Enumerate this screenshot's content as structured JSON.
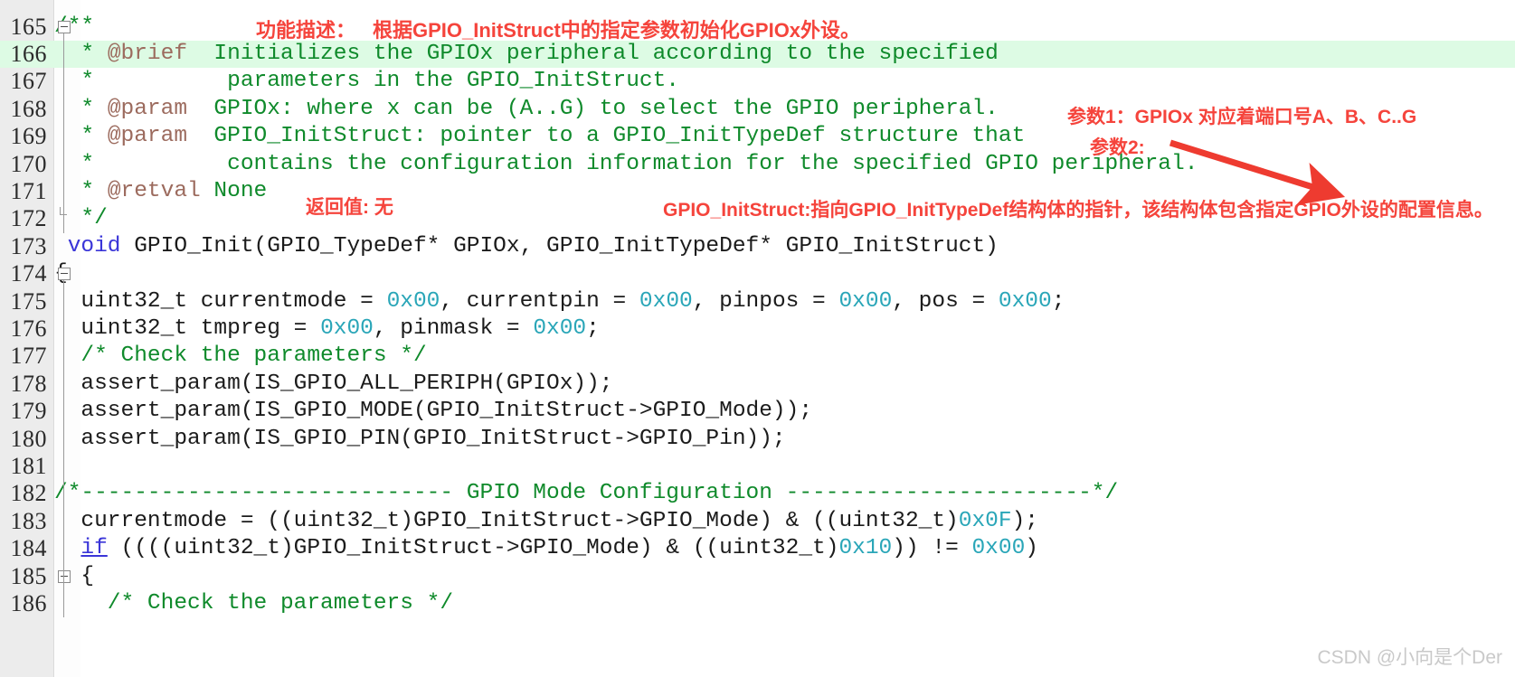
{
  "editor": {
    "gutter_bg": "#ececec",
    "highlight_color": "#ddfbe4",
    "comment_color": "#0f8a2b",
    "keyword_color": "#3a35d8",
    "number_color": "#2aa6b8",
    "doc_tag_color": "#9c6b5e",
    "annotation_color": "#f5443c",
    "partial_top_line": "164",
    "highlighted_line": "166",
    "lines": [
      {
        "number": "165",
        "fold": "open",
        "tokens": [
          {
            "t": "/**",
            "c": "cmt"
          }
        ]
      },
      {
        "number": "166",
        "fold": "bar",
        "highlight": true,
        "tokens": [
          {
            "t": "  * ",
            "c": "cmt"
          },
          {
            "t": "@brief",
            "c": "tag"
          },
          {
            "t": "  Initializes the GPIOx peripheral according to the specified",
            "c": "cmt"
          }
        ]
      },
      {
        "number": "167",
        "fold": "bar",
        "tokens": [
          {
            "t": "  *          parameters in the GPIO_InitStruct.",
            "c": "cmt"
          }
        ]
      },
      {
        "number": "168",
        "fold": "bar",
        "tokens": [
          {
            "t": "  * ",
            "c": "cmt"
          },
          {
            "t": "@param",
            "c": "tag"
          },
          {
            "t": "  GPIOx: where x can be (A..G) to select the GPIO peripheral.",
            "c": "cmt"
          }
        ]
      },
      {
        "number": "169",
        "fold": "bar",
        "tokens": [
          {
            "t": "  * ",
            "c": "cmt"
          },
          {
            "t": "@param",
            "c": "tag"
          },
          {
            "t": "  GPIO_InitStruct: pointer to a GPIO_InitTypeDef structure that",
            "c": "cmt"
          }
        ]
      },
      {
        "number": "170",
        "fold": "bar",
        "tokens": [
          {
            "t": "  *          contains the configuration information for the specified GPIO peripheral.",
            "c": "cmt"
          }
        ]
      },
      {
        "number": "171",
        "fold": "bar",
        "tokens": [
          {
            "t": "  * ",
            "c": "cmt"
          },
          {
            "t": "@retval",
            "c": "tag"
          },
          {
            "t": " None",
            "c": "cmt"
          }
        ]
      },
      {
        "number": "172",
        "fold": "end",
        "tokens": [
          {
            "t": "  */",
            "c": "cmt"
          }
        ]
      },
      {
        "number": "173",
        "fold": "none",
        "tokens": [
          {
            "t": " ",
            "c": "pln"
          },
          {
            "t": "void",
            "c": "kw"
          },
          {
            "t": " GPIO_Init(GPIO_TypeDef* GPIOx, GPIO_InitTypeDef* GPIO_InitStruct)",
            "c": "pln"
          }
        ]
      },
      {
        "number": "174",
        "fold": "open",
        "tokens": [
          {
            "t": "{",
            "c": "pln"
          }
        ]
      },
      {
        "number": "175",
        "fold": "bar",
        "tokens": [
          {
            "t": "  uint32_t currentmode = ",
            "c": "pln"
          },
          {
            "t": "0x00",
            "c": "num"
          },
          {
            "t": ", currentpin = ",
            "c": "pln"
          },
          {
            "t": "0x00",
            "c": "num"
          },
          {
            "t": ", pinpos = ",
            "c": "pln"
          },
          {
            "t": "0x00",
            "c": "num"
          },
          {
            "t": ", pos = ",
            "c": "pln"
          },
          {
            "t": "0x00",
            "c": "num"
          },
          {
            "t": ";",
            "c": "pln"
          }
        ]
      },
      {
        "number": "176",
        "fold": "bar",
        "tokens": [
          {
            "t": "  uint32_t tmpreg = ",
            "c": "pln"
          },
          {
            "t": "0x00",
            "c": "num"
          },
          {
            "t": ", pinmask = ",
            "c": "pln"
          },
          {
            "t": "0x00",
            "c": "num"
          },
          {
            "t": ";",
            "c": "pln"
          }
        ]
      },
      {
        "number": "177",
        "fold": "bar",
        "tokens": [
          {
            "t": "  /* Check the parameters */",
            "c": "cmt"
          }
        ]
      },
      {
        "number": "178",
        "fold": "bar",
        "tokens": [
          {
            "t": "  assert_param(IS_GPIO_ALL_PERIPH(GPIOx));",
            "c": "pln"
          }
        ]
      },
      {
        "number": "179",
        "fold": "bar",
        "tokens": [
          {
            "t": "  assert_param(IS_GPIO_MODE(GPIO_InitStruct->GPIO_Mode));",
            "c": "pln"
          }
        ]
      },
      {
        "number": "180",
        "fold": "bar",
        "tokens": [
          {
            "t": "  assert_param(IS_GPIO_PIN(GPIO_InitStruct->GPIO_Pin));",
            "c": "pln"
          }
        ]
      },
      {
        "number": "181",
        "fold": "bar",
        "tokens": [
          {
            "t": "",
            "c": "pln"
          }
        ]
      },
      {
        "number": "182",
        "fold": "bar",
        "tokens": [
          {
            "t": "/*---------------------------- GPIO Mode Configuration -----------------------*/",
            "c": "cmt"
          }
        ]
      },
      {
        "number": "183",
        "fold": "bar",
        "tokens": [
          {
            "t": "  currentmode = ((uint32_t)GPIO_InitStruct->GPIO_Mode) & ((uint32_t)",
            "c": "pln"
          },
          {
            "t": "0x0F",
            "c": "num"
          },
          {
            "t": ");",
            "c": "pln"
          }
        ]
      },
      {
        "number": "184",
        "fold": "bar",
        "tokens": [
          {
            "t": "  ",
            "c": "pln"
          },
          {
            "t": "if",
            "c": "kw-u"
          },
          {
            "t": " ((((uint32_t)GPIO_InitStruct->GPIO_Mode) & ((uint32_t)",
            "c": "pln"
          },
          {
            "t": "0x10",
            "c": "num"
          },
          {
            "t": ")) != ",
            "c": "pln"
          },
          {
            "t": "0x00",
            "c": "num"
          },
          {
            "t": ")",
            "c": "pln"
          }
        ]
      },
      {
        "number": "185",
        "fold": "open",
        "tokens": [
          {
            "t": "  {",
            "c": "pln"
          }
        ]
      },
      {
        "number": "186",
        "fold": "bar",
        "tokens": [
          {
            "t": "    /* Check the parameters */",
            "c": "cmt"
          }
        ]
      }
    ]
  },
  "annotations": {
    "function_desc_label": "功能描述：",
    "function_desc_text": "根据GPIO_InitStruct中的指定参数初始化GPIOx外设。",
    "param1": "参数1：GPIOx 对应着端口号A、B、C..G",
    "param2": "参数2:",
    "retval": "返回值: 无",
    "param2_detail": "GPIO_InitStruct:指向GPIO_InitTypeDef结构体的指针，该结构体包含指定GPIO外设的配置信息。"
  },
  "watermark": {
    "text": "CSDN @小向是个Der"
  }
}
